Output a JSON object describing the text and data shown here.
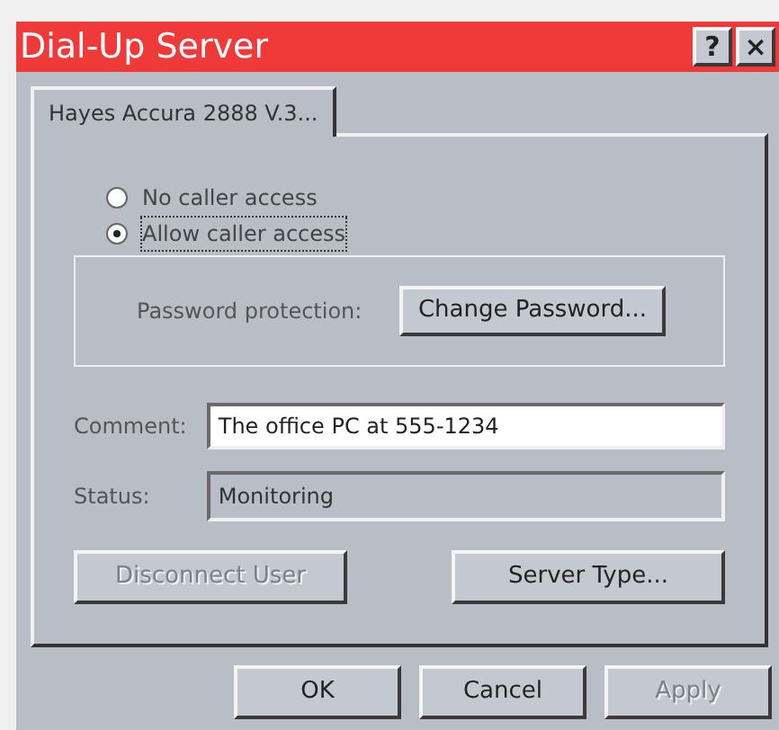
{
  "window": {
    "title": "Dial-Up Server",
    "title_buttons": [
      "?",
      "×"
    ]
  },
  "tabs": [
    {
      "label": "Hayes Accura 2888 V.3...",
      "selected": true
    }
  ],
  "access_options": [
    {
      "label": "No caller access",
      "selected": false
    },
    {
      "label": "Allow caller access",
      "selected": true
    }
  ],
  "password": {
    "label": "Password protection:",
    "button": "Change Password..."
  },
  "comment": {
    "label": "Comment:",
    "value": "The office PC at 555-1234"
  },
  "status": {
    "label": "Status:",
    "value": "Monitoring"
  },
  "panel_buttons": [
    {
      "label": "Disconnect User",
      "disabled": true
    },
    {
      "label": "Server Type...",
      "disabled": false
    }
  ],
  "dialog_buttons": [
    {
      "label": "OK",
      "disabled": false
    },
    {
      "label": "Cancel",
      "disabled": false
    },
    {
      "label": "Apply",
      "disabled": true
    }
  ]
}
